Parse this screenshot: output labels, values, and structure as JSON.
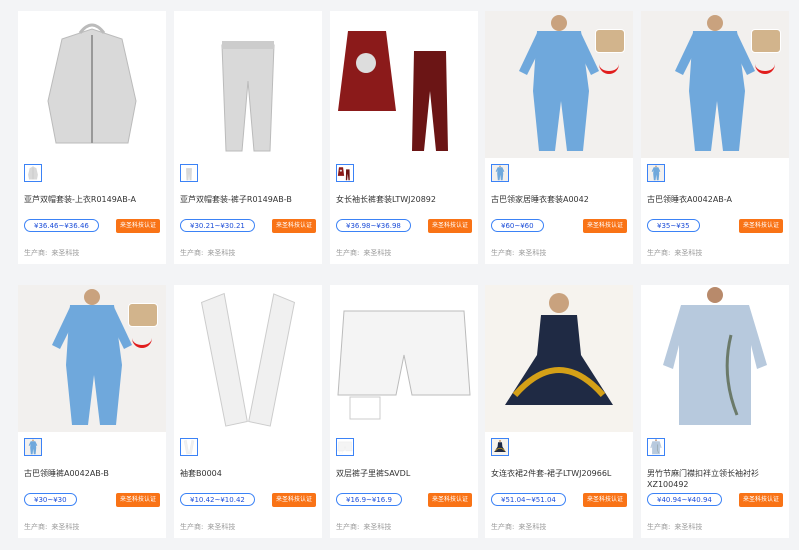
{
  "products": [
    {
      "name": "亚芦双帽套装-上衣R0149AB-A",
      "price": "¥36.46~¥36.46",
      "badge": "来圣科技认证",
      "supplier_label": "生产商:",
      "supplier": "来圣科技",
      "image_kind": "zip-hoodie-gray",
      "has_overlay": false
    },
    {
      "name": "亚芦双帽套装-裤子R0149AB-B",
      "price": "¥30.21~¥30.21",
      "badge": "来圣科技认证",
      "supplier_label": "生产商:",
      "supplier": "来圣科技",
      "image_kind": "jogger-pants-gray",
      "has_overlay": false
    },
    {
      "name": "女长袖长裤套装LTWJ20892",
      "price": "¥36.98~¥36.98",
      "badge": "来圣科技认证",
      "supplier_label": "生产商:",
      "supplier": "来圣科技",
      "image_kind": "dress-leggings-red",
      "has_overlay": false
    },
    {
      "name": "古巴领家居睡衣套装A0042",
      "price": "¥60~¥60",
      "badge": "来圣科技认证",
      "supplier_label": "生产商:",
      "supplier": "来圣科技",
      "image_kind": "pajama-blue-dog",
      "has_overlay": true
    },
    {
      "name": "古巴领睡衣A0042AB-A",
      "price": "¥35~¥35",
      "badge": "来圣科技认证",
      "supplier_label": "生产商:",
      "supplier": "来圣科技",
      "image_kind": "pajama-blue-dog",
      "has_overlay": true
    },
    {
      "name": "古巴领睡裤A0042AB-B",
      "price": "¥30~¥30",
      "badge": "来圣科技认证",
      "supplier_label": "生产商:",
      "supplier": "来圣科技",
      "image_kind": "pajama-blue-dog",
      "has_overlay": true
    },
    {
      "name": "袖套B0004",
      "price": "¥10.42~¥10.42",
      "badge": "来圣科技认证",
      "supplier_label": "生产商:",
      "supplier": "来圣科技",
      "image_kind": "arm-sleeves-white",
      "has_overlay": false
    },
    {
      "name": "双层裤子里裤SAVDL",
      "price": "¥16.9~¥16.9",
      "badge": "来圣科技认证",
      "supplier_label": "生产商:",
      "supplier": "来圣科技",
      "image_kind": "shorts-white",
      "has_overlay": false
    },
    {
      "name": "女连衣裙2件套-裙子LTWJ20966L",
      "price": "¥51.04~¥51.04",
      "badge": "来圣科技认证",
      "supplier_label": "生产商:",
      "supplier": "来圣科技",
      "image_kind": "dress-navy-gold",
      "has_overlay": false
    },
    {
      "name": "男竹节麻门襟扣袢立领长袖衬衫XZ100492",
      "price": "¥40.94~¥40.94",
      "badge": "来圣科技认证",
      "supplier_label": "生产商:",
      "supplier": "来圣科技",
      "image_kind": "shirt-light-blue",
      "has_overlay": false
    }
  ],
  "colors": {
    "accent": "#3b82f6",
    "badge": "#f97316",
    "pajama": "#6fa8dc",
    "gray_garment": "#d9d9d9",
    "red_garment": "#8b1a1a",
    "navy": "#1f2a44",
    "gold": "#d4a017",
    "shirt": "#b7c9dd"
  }
}
